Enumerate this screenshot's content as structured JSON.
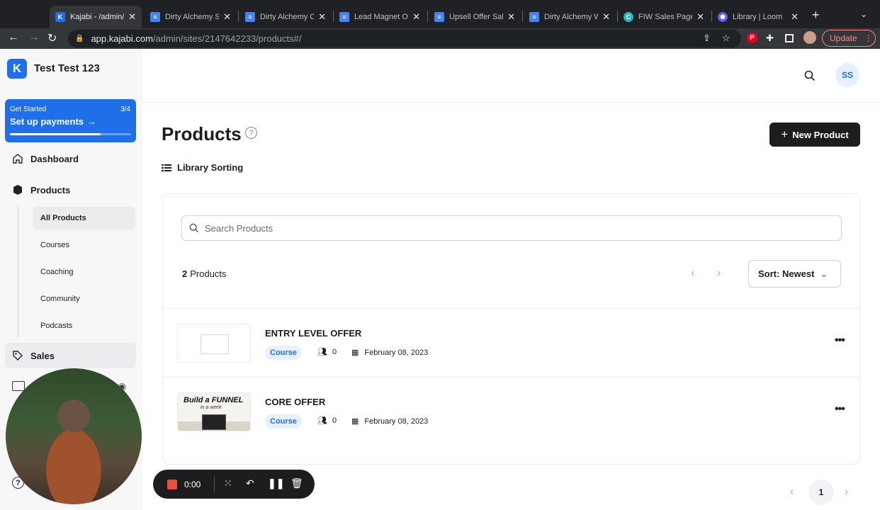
{
  "browser": {
    "tabs": [
      {
        "title": "Kajabi - /admin/",
        "favicon": "kajabi",
        "color": "#1f6feb",
        "active": true
      },
      {
        "title": "Dirty Alchemy S",
        "favicon": "docs",
        "color": "#4285f4",
        "active": false
      },
      {
        "title": "Dirty Alchemy O",
        "favicon": "docs",
        "color": "#4285f4",
        "active": false
      },
      {
        "title": "Lead Magnet Op",
        "favicon": "docs",
        "color": "#4285f4",
        "active": false
      },
      {
        "title": "Upsell Offer Sal",
        "favicon": "docs",
        "color": "#4285f4",
        "active": false
      },
      {
        "title": "Dirty Alchemy W",
        "favicon": "docs",
        "color": "#4285f4",
        "active": false
      },
      {
        "title": "FIW Sales Page",
        "favicon": "circle",
        "color": "#2bb3c0",
        "active": false
      },
      {
        "title": "Library | Loom",
        "favicon": "loom",
        "color": "#625df5",
        "active": false
      }
    ],
    "url_domain": "app.kajabi.com",
    "url_path": "/admin/sites/2147642233/products#/",
    "update_label": "Update"
  },
  "sidebar": {
    "site_name": "Test Test 123",
    "get_started": {
      "label": "Get Started",
      "count": "3/4",
      "title": "Set up payments",
      "progress": 0.75
    },
    "items": [
      {
        "label": "Dashboard",
        "icon": "home-icon"
      },
      {
        "label": "Products",
        "icon": "box-icon"
      },
      {
        "label": "Sales",
        "icon": "tag-icon"
      }
    ],
    "sub_items": [
      {
        "label": "All Products",
        "selected": true
      },
      {
        "label": "Courses",
        "selected": false
      },
      {
        "label": "Coaching",
        "selected": false
      },
      {
        "label": "Community",
        "selected": false
      },
      {
        "label": "Podcasts",
        "selected": false
      }
    ]
  },
  "header": {
    "avatar_initials": "SS"
  },
  "page": {
    "title": "Products",
    "new_product_label": "New Product",
    "library_sorting_label": "Library Sorting",
    "search_placeholder": "Search Products",
    "count_number": "2",
    "count_label": "Products",
    "sort_label": "Sort: Newest",
    "current_page": "1"
  },
  "products": [
    {
      "title": "ENTRY LEVEL OFFER",
      "type": "Course",
      "members": "0",
      "date": "February 08, 2023",
      "thumb": "placeholder"
    },
    {
      "title": "CORE OFFER",
      "type": "Course",
      "members": "0",
      "date": "February 08, 2023",
      "thumb": "funnel",
      "thumb_title": "Build a FUNNEL",
      "thumb_sub": "in a week"
    }
  ],
  "recorder": {
    "time": "0:00"
  },
  "colors": {
    "accent": "#1f6feb",
    "dark": "#1d1d1f",
    "record": "#e8503a"
  }
}
